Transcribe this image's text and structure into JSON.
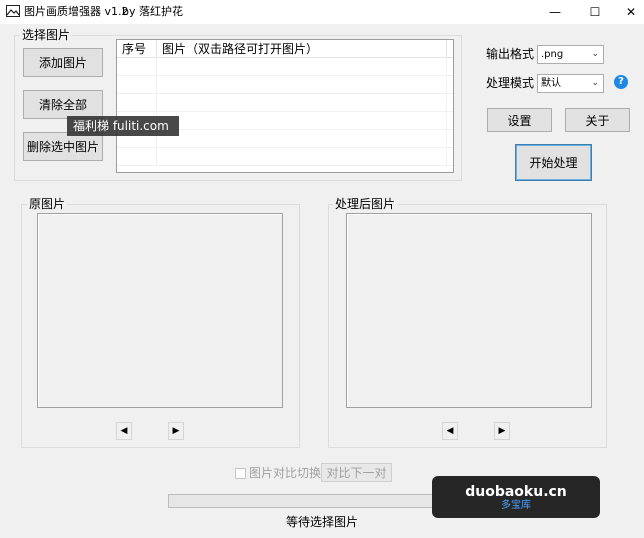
{
  "window": {
    "title": "图片画质增强器 v1.2",
    "author": "by 落红护花",
    "controls": {
      "minimize": "—",
      "maximize": "☐",
      "close": "✕"
    }
  },
  "select_group": {
    "title": "选择图片",
    "add_button": "添加图片",
    "clear_button": "清除全部",
    "delete_button": "删除选中图片"
  },
  "file_list": {
    "columns": [
      "序号",
      "图片（双击路径可打开图片）"
    ],
    "rows": [
      [
        "",
        ""
      ],
      [
        "",
        ""
      ],
      [
        "",
        ""
      ],
      [
        "",
        ""
      ],
      [
        "",
        ""
      ],
      [
        "",
        ""
      ]
    ]
  },
  "options": {
    "format_label": "输出格式",
    "format_value": ".png",
    "mode_label": "处理模式",
    "mode_value": "默认",
    "help_icon": "?",
    "settings_button": "设置",
    "about_button": "关于",
    "start_button": "开始处理"
  },
  "panes": {
    "original_title": "原图片",
    "processed_title": "处理后图片",
    "prev_icon": "◀",
    "next_icon": "▶"
  },
  "compare": {
    "checkbox_label": "图片对比切换",
    "checked": false,
    "next_pair_button": "对比下一对"
  },
  "progress": {
    "value": 0
  },
  "status_text": "等待选择图片",
  "watermarks": {
    "top": "福利梯 fuliti.com",
    "bottom_main": "duobaoku.cn",
    "bottom_sub": "多宝库"
  },
  "colors": {
    "accent": "#3c7fb1",
    "help": "#1e88e5",
    "progress": "#06b025"
  }
}
